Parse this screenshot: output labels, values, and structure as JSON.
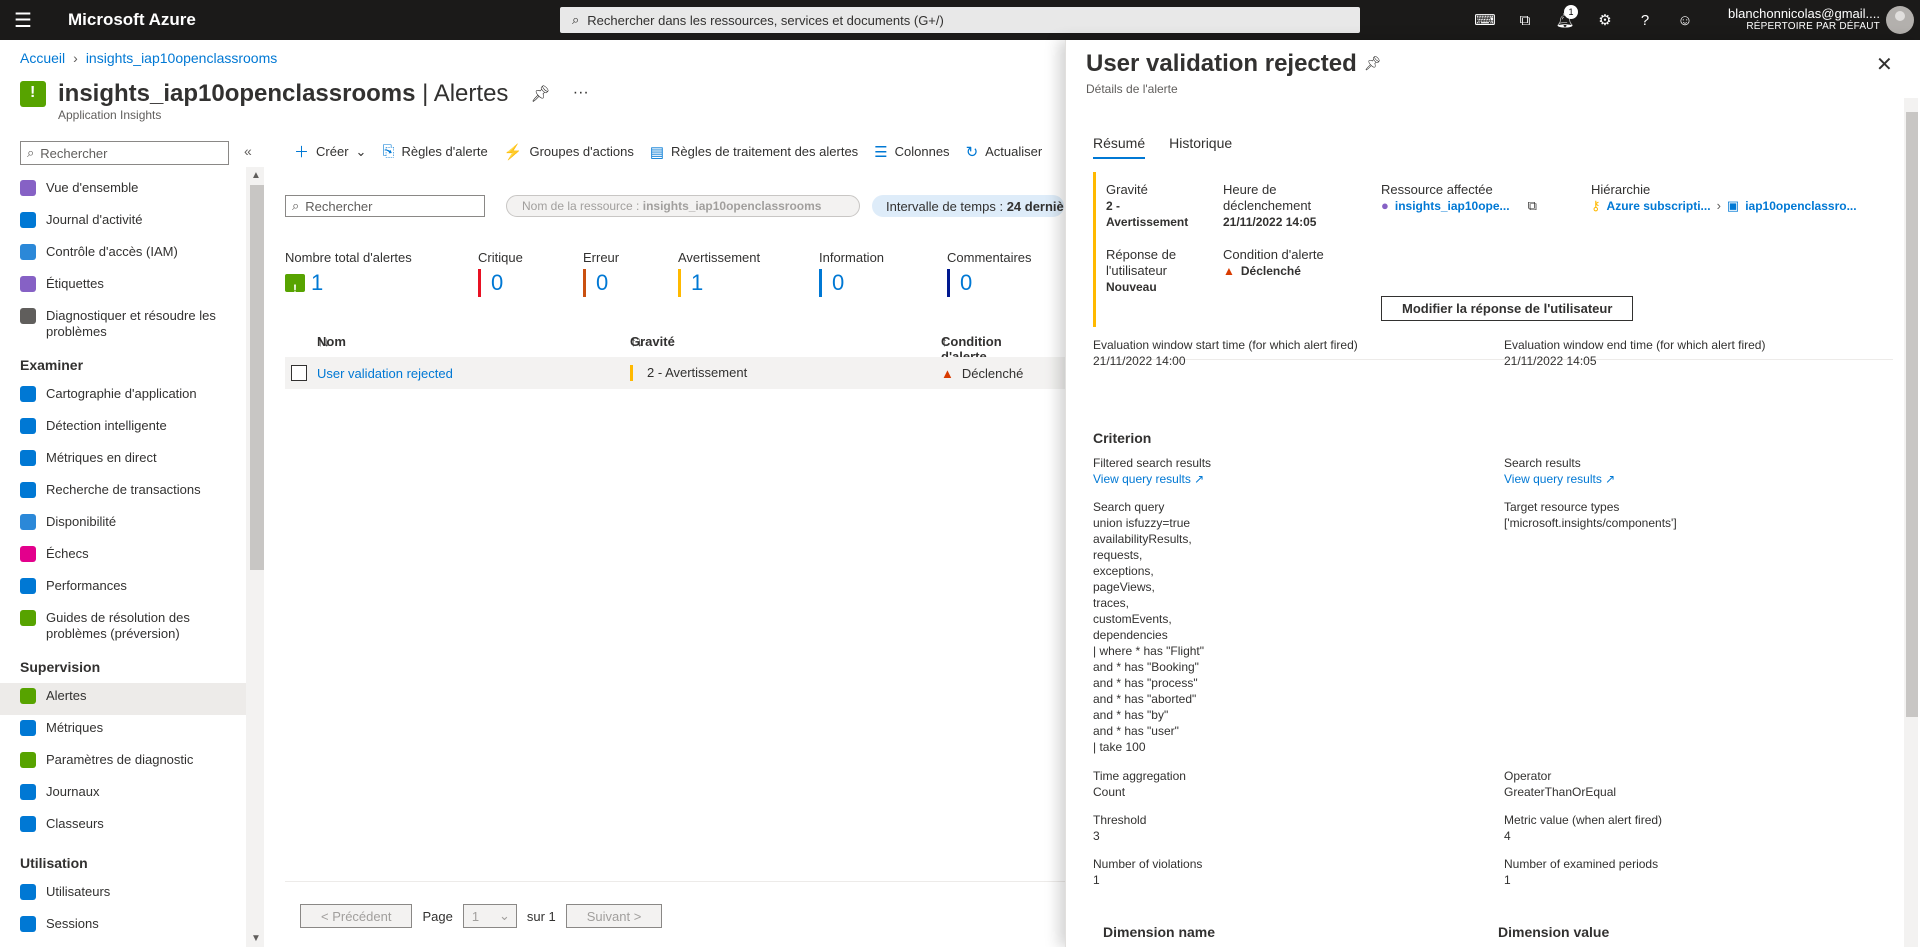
{
  "topbar": {
    "brand": "Microsoft Azure",
    "search_placeholder": "Rechercher dans les ressources, services et documents (G+/)",
    "notification_count": "1",
    "account_email": "blanchonnicolas@gmail....",
    "account_directory": "RÉPERTOIRE PAR DÉFAUT"
  },
  "breadcrumb": {
    "home": "Accueil",
    "resource": "insights_iap10openclassrooms"
  },
  "page": {
    "resource_name": "insights_iap10openclassrooms",
    "title_suffix": "| Alertes",
    "subtitle": "Application Insights"
  },
  "sidebar": {
    "search_placeholder": "Rechercher",
    "items_general": [
      {
        "label": "Vue d'ensemble",
        "color": "#8661c5"
      },
      {
        "label": "Journal d'activité",
        "color": "#0078d4"
      },
      {
        "label": "Contrôle d'accès (IAM)",
        "color": "#2b88d8"
      },
      {
        "label": "Étiquettes",
        "color": "#8661c5"
      },
      {
        "label": "Diagnostiquer et résoudre les problèmes",
        "color": "#605e5c"
      }
    ],
    "section_examiner": "Examiner",
    "items_examiner": [
      {
        "label": "Cartographie d'application",
        "color": "#0078d4"
      },
      {
        "label": "Détection intelligente",
        "color": "#0078d4"
      },
      {
        "label": "Métriques en direct",
        "color": "#0078d4"
      },
      {
        "label": "Recherche de transactions",
        "color": "#0078d4"
      },
      {
        "label": "Disponibilité",
        "color": "#2b88d8"
      },
      {
        "label": "Échecs",
        "color": "#e3008c"
      },
      {
        "label": "Performances",
        "color": "#0078d4"
      },
      {
        "label": "Guides de résolution des problèmes (préversion)",
        "color": "#57a300"
      }
    ],
    "section_supervision": "Supervision",
    "items_supervision": [
      {
        "label": "Alertes",
        "color": "#57a300"
      },
      {
        "label": "Métriques",
        "color": "#0078d4"
      },
      {
        "label": "Paramètres de diagnostic",
        "color": "#57a300"
      },
      {
        "label": "Journaux",
        "color": "#0078d4"
      },
      {
        "label": "Classeurs",
        "color": "#0078d4"
      }
    ],
    "section_utilisation": "Utilisation",
    "items_utilisation": [
      {
        "label": "Utilisateurs",
        "color": "#0078d4"
      },
      {
        "label": "Sessions",
        "color": "#0078d4"
      }
    ]
  },
  "commandbar": {
    "create": "Créer",
    "alert_rules": "Règles d'alerte",
    "action_groups": "Groupes d'actions",
    "processing_rules": "Règles de traitement des alertes",
    "columns": "Colonnes",
    "refresh": "Actualiser"
  },
  "filters": {
    "search_placeholder": "Rechercher",
    "resource_label": "Nom de la ressource :",
    "resource_value": "insights_iap10openclassrooms",
    "time_label": "Intervalle de temps :",
    "time_value": "24 derniè"
  },
  "summary": {
    "total_label": "Nombre total d'alertes",
    "total_value": "1",
    "critical_label": "Critique",
    "critical_value": "0",
    "error_label": "Erreur",
    "error_value": "0",
    "warning_label": "Avertissement",
    "warning_value": "1",
    "info_label": "Information",
    "info_value": "0",
    "verbose_label": "Commentaires",
    "verbose_value": "0",
    "colors": {
      "critical": "#e81123",
      "error": "#ca5010",
      "warning": "#ffb900",
      "info": "#0078d4",
      "verbose": "#00188f"
    }
  },
  "grid": {
    "col_name": "Nom",
    "col_severity": "Gravité",
    "col_condition": "Condition d'alerte",
    "row": {
      "name": "User validation rejected",
      "severity": "2 - Avertissement",
      "condition": "Déclenché"
    }
  },
  "pager": {
    "prev": "< Précédent",
    "page_label": "Page",
    "page_value": "1",
    "of_label": "sur 1",
    "next": "Suivant >"
  },
  "panel": {
    "title": "User validation rejected",
    "subtitle": "Détails de l'alerte",
    "tabs": [
      "Résumé",
      "Historique"
    ],
    "severity_label": "Gravité",
    "severity_value": "2 - Avertissement",
    "fired_label": "Heure de déclenchement",
    "fired_value": "21/11/2022 14:05",
    "resource_label": "Ressource affectée",
    "resource_value": "insights_iap10ope...",
    "hierarchy_label": "Hiérarchie",
    "hierarchy_sub": "Azure subscripti...",
    "hierarchy_rg": "iap10openclassro...",
    "user_response_label": "Réponse de l'utilisateur",
    "user_response_value": "Nouveau",
    "condition_label": "Condition d'alerte",
    "condition_value": "Déclenché",
    "modify_button": "Modifier la réponse de l'utilisateur",
    "eval_start_label": "Evaluation window start time (for which alert fired)",
    "eval_start_value": "21/11/2022 14:00",
    "eval_end_label": "Evaluation window end time (for which alert fired)",
    "eval_end_value": "21/11/2022 14:05",
    "criterion_heading": "Criterion",
    "filtered_label": "Filtered search results",
    "filtered_link": "View query results",
    "search_results_label": "Search results",
    "search_results_link": "View query results",
    "search_query_label": "Search query",
    "search_query_lines": [
      "union isfuzzy=true",
      "availabilityResults,",
      "requests,",
      "exceptions,",
      "pageViews,",
      "traces,",
      "customEvents,",
      "dependencies",
      "| where * has \"Flight\"",
      "and * has \"Booking\"",
      "and * has \"process\"",
      "and * has \"aborted\"",
      "and * has \"by\"",
      "and * has \"user\"",
      "| take 100"
    ],
    "target_types_label": "Target resource types",
    "target_types_value": "['microsoft.insights/components']",
    "time_agg_label": "Time aggregation",
    "time_agg_value": "Count",
    "operator_label": "Operator",
    "operator_value": "GreaterThanOrEqual",
    "threshold_label": "Threshold",
    "threshold_value": "3",
    "metric_value_label": "Metric value (when alert fired)",
    "metric_value": "4",
    "violations_label": "Number of violations",
    "violations_value": "1",
    "examined_label": "Number of examined periods",
    "examined_value": "1",
    "dim_name_header": "Dimension name",
    "dim_value_header": "Dimension value"
  }
}
